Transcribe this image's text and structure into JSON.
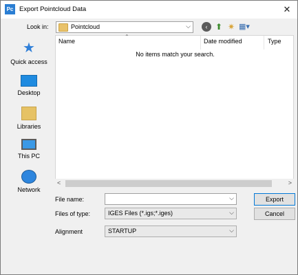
{
  "window": {
    "title": "Export Pointcloud Data",
    "app_icon": "Pc",
    "close_glyph": "✕"
  },
  "lookin": {
    "label": "Look in:",
    "value": "Pointcloud"
  },
  "toolbar": {
    "back_glyph": "‹",
    "up_glyph": "⬆",
    "newfolder_glyph": "✷",
    "views_glyph": "▦▾"
  },
  "places": [
    {
      "label": "Quick access",
      "icon": "star-icon"
    },
    {
      "label": "Desktop",
      "icon": "desktop-icon"
    },
    {
      "label": "Libraries",
      "icon": "libraries-icon"
    },
    {
      "label": "This PC",
      "icon": "computer-icon"
    },
    {
      "label": "Network",
      "icon": "network-icon"
    }
  ],
  "filelist": {
    "columns": [
      "Name",
      "Date modified",
      "Type"
    ],
    "empty_message": "No items match your search."
  },
  "form": {
    "filename_label": "File name:",
    "filename_value": "",
    "filetype_label": "Files of type:",
    "filetype_value": "IGES Files (*.igs;*.iges)",
    "alignment_label": "Alignment",
    "alignment_value": "STARTUP"
  },
  "buttons": {
    "export": "Export",
    "cancel": "Cancel"
  }
}
